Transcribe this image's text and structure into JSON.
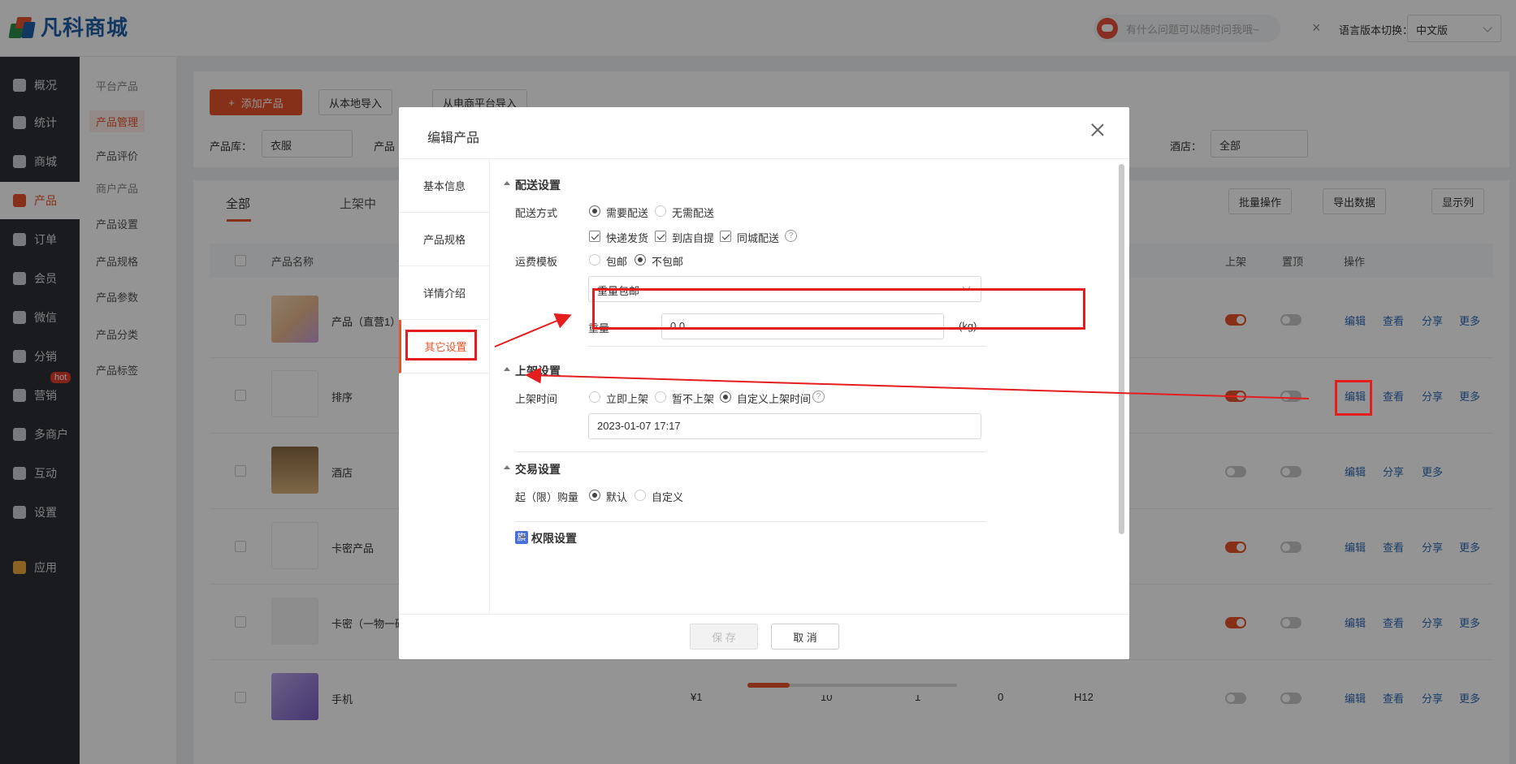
{
  "app": {
    "brand": "凡科商城"
  },
  "topbar": {
    "assistant_placeholder": "有什么问题可以随时问我哦~",
    "close_glyph": "×",
    "language_label": "语言版本切换：",
    "language_value": "中文版"
  },
  "sidebar": {
    "items": [
      {
        "label": "概况"
      },
      {
        "label": "统计"
      },
      {
        "label": "商城"
      },
      {
        "label": "产品"
      },
      {
        "label": "订单"
      },
      {
        "label": "会员"
      },
      {
        "label": "微信"
      },
      {
        "label": "分销"
      },
      {
        "label": "营销"
      },
      {
        "label": "多商户"
      },
      {
        "label": "互动"
      },
      {
        "label": "设置"
      },
      {
        "label": "应用"
      }
    ],
    "hot_badge": "hot"
  },
  "subnav": {
    "group1": "平台产品",
    "items1": [
      "产品管理",
      "产品评价"
    ],
    "group2": "商户产品",
    "items2": [
      "产品设置",
      "产品规格",
      "产品参数",
      "产品分类",
      "产品标签"
    ]
  },
  "toolbar": {
    "add_product": "添加产品",
    "import_local": "从本地导入",
    "import_platform": "从电商平台导入"
  },
  "filters": {
    "lib_label": "产品库：",
    "lib_value": "衣服",
    "product_label_partial": "产品",
    "store_label": "酒店：",
    "store_value": "全部"
  },
  "tabs": {
    "all": "全部",
    "onshelf": "上架中"
  },
  "actions": {
    "batch": "批量操作",
    "export": "导出数据",
    "columns": "显示列"
  },
  "table": {
    "headers": {
      "name": "产品名称",
      "onshelf": "上架",
      "top": "置顶",
      "ops": "操作"
    },
    "rows": [
      {
        "name": "产品（直营1）",
        "onshelf": true,
        "top": false
      },
      {
        "name": "排序",
        "onshelf": true,
        "top": false
      },
      {
        "name": "酒店",
        "onshelf": false,
        "top": false
      },
      {
        "name": "卡密产品",
        "onshelf": true,
        "top": false
      },
      {
        "name": "卡密（一物一码",
        "onshelf": true,
        "top": false
      },
      {
        "name": "手机",
        "onshelf": false,
        "top": false,
        "price": "¥1",
        "c1": "10",
        "c2": "1",
        "c3": "0",
        "c4": "H12"
      }
    ],
    "ops": {
      "edit": "编辑",
      "view": "查看",
      "share": "分享",
      "more": "更多"
    }
  },
  "dialog": {
    "title": "编辑产品",
    "nav": [
      "基本信息",
      "产品规格",
      "详情介绍",
      "其它设置"
    ],
    "delivery": {
      "title": "配送设置",
      "method_label": "配送方式",
      "need": "需要配送",
      "no_need": "无需配送",
      "express": "快递发货",
      "pickup": "到店自提",
      "local": "同城配送",
      "freight_label": "运费模板",
      "free": "包邮",
      "not_free": "不包邮",
      "template_value": "重量包邮",
      "weight_label": "重量",
      "weight_value": "0.0",
      "weight_unit": "(kg)"
    },
    "shelf": {
      "title": "上架设置",
      "time_label": "上架时间",
      "now": "立即上架",
      "not_now": "暂不上架",
      "custom": "自定义上架时间",
      "datetime": "2023-01-07 17:17"
    },
    "trade": {
      "title": "交易设置",
      "min_label": "起（限）购量",
      "default": "默认",
      "custom": "自定义"
    },
    "perm": {
      "title": "权限设置",
      "badge": "旗"
    },
    "save": "保 存",
    "cancel": "取 消"
  },
  "colors": {
    "accent": "#e8542b",
    "annotation": "#e41e1e",
    "link": "#2d6ab5"
  }
}
